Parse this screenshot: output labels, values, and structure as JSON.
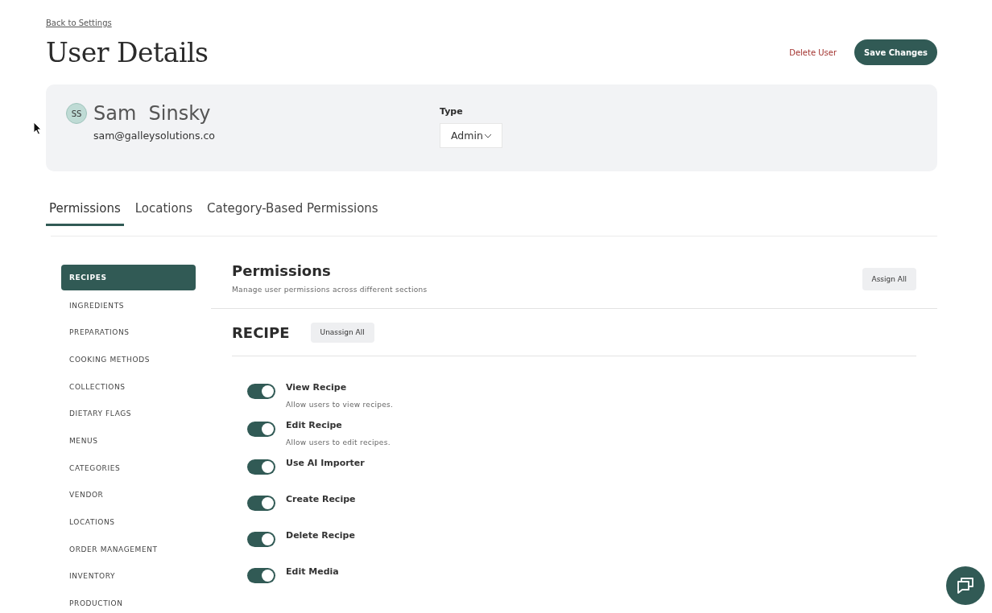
{
  "back_link": "Back to Settings",
  "title": "User Details",
  "header_actions": {
    "delete": "Delete User",
    "save": "Save Changes"
  },
  "user": {
    "initials": "SS",
    "first_name": "Sam",
    "last_name": "Sinsky",
    "email": "sam@galleysolutions.co",
    "type_label": "Type",
    "type_value": "Admin"
  },
  "tabs": [
    {
      "label": "Permissions",
      "selected": true
    },
    {
      "label": "Locations",
      "selected": false
    },
    {
      "label": "Category-Based Permissions",
      "selected": false
    }
  ],
  "sidebar": {
    "items": [
      {
        "label": "RECIPES",
        "selected": true
      },
      {
        "label": "INGREDIENTS",
        "selected": false
      },
      {
        "label": "PREPARATIONS",
        "selected": false
      },
      {
        "label": "COOKING METHODS",
        "selected": false
      },
      {
        "label": "COLLECTIONS",
        "selected": false
      },
      {
        "label": "DIETARY FLAGS",
        "selected": false
      },
      {
        "label": "MENUS",
        "selected": false
      },
      {
        "label": "CATEGORIES",
        "selected": false
      },
      {
        "label": "VENDOR",
        "selected": false
      },
      {
        "label": "LOCATIONS",
        "selected": false
      },
      {
        "label": "ORDER MANAGEMENT",
        "selected": false
      },
      {
        "label": "INVENTORY",
        "selected": false
      },
      {
        "label": "PRODUCTION",
        "selected": false
      }
    ]
  },
  "panel": {
    "title": "Permissions",
    "subtitle": "Manage user permissions across different sections",
    "assign_all": "Assign All"
  },
  "section": {
    "title": "RECIPE",
    "unassign_all": "Unassign All",
    "permissions": [
      {
        "label": "View Recipe",
        "description": "Allow users to view recipes.",
        "on": true
      },
      {
        "label": "Edit Recipe",
        "description": "Allow users to edit recipes.",
        "on": true
      },
      {
        "label": "Use AI Importer",
        "on": true
      },
      {
        "label": "Create Recipe",
        "on": true
      },
      {
        "label": "Delete Recipe",
        "on": true
      },
      {
        "label": "Edit Media",
        "on": true
      }
    ]
  }
}
